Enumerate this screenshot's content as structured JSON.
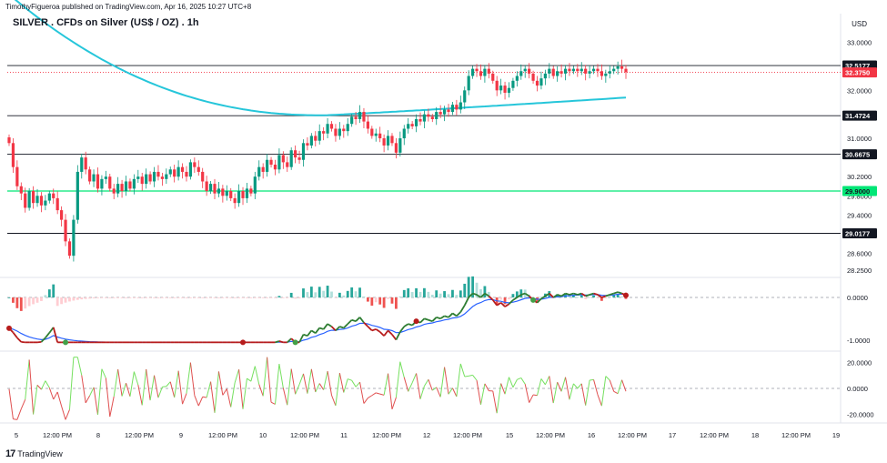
{
  "header": {
    "published": "TimothyFigueroa published on TradingView.com, Apr 16, 2025 10:27 UTC+8",
    "symbol": "SILVER . CFDs on Silver (US$ / OZ) . 1h",
    "currency": "USD"
  },
  "brand": {
    "logo": "TradingView"
  },
  "colors": {
    "up": "#089981",
    "down": "#f23645",
    "ma": "#26c6da",
    "macd_fast": "#2e7d32",
    "macd_slow": "#2962ff",
    "hist_up": "#26a69a",
    "hist_up_light": "#b2dfdb",
    "hist_down": "#ef5350",
    "hist_down_light": "#ffcdd2",
    "osc_up": "#76e060",
    "osc_down": "#e05050",
    "green_level": "#00e676"
  },
  "chart_data": [
    {
      "type": "candlestick",
      "price_ticks": [
        "33.0000",
        "32.0000",
        "31.0000",
        "30.2000",
        "29.8000",
        "29.4000",
        "28.6000",
        "28.2500"
      ],
      "price_labels": [
        {
          "value": "32.5177",
          "kind": "black"
        },
        {
          "value": "32.3750",
          "kind": "red"
        },
        {
          "value": "31.4724",
          "kind": "black"
        },
        {
          "value": "30.6675",
          "kind": "black"
        },
        {
          "value": "29.9000",
          "kind": "green"
        },
        {
          "value": "29.0177",
          "kind": "black"
        }
      ],
      "horizontal_levels": [
        32.5177,
        31.4724,
        30.6675,
        29.9,
        29.0177
      ],
      "green_level": 29.9,
      "last_price": 32.375,
      "time_labels": [
        "5",
        "12:00 PM",
        "8",
        "12:00 PM",
        "9",
        "12:00 PM",
        "10",
        "12:00 PM",
        "11",
        "12:00 PM",
        "12",
        "12:00 PM",
        "15",
        "12:00 PM",
        "16",
        "12:00 PM",
        "17",
        "12:00 PM",
        "18",
        "12:00 PM",
        "19"
      ],
      "closes": [
        30.9,
        30.4,
        30.0,
        29.85,
        29.55,
        29.9,
        29.65,
        29.8,
        29.6,
        29.7,
        29.85,
        29.75,
        29.5,
        29.3,
        28.85,
        28.55,
        29.3,
        30.3,
        30.6,
        30.35,
        30.1,
        30.25,
        29.95,
        30.15,
        30.2,
        29.95,
        29.85,
        30.05,
        29.9,
        30.1,
        29.95,
        30.15,
        30.2,
        30.05,
        30.25,
        30.1,
        30.3,
        30.2,
        30.15,
        30.25,
        30.35,
        30.2,
        30.4,
        30.3,
        30.2,
        30.5,
        30.4,
        30.3,
        30.1,
        29.9,
        30.05,
        29.85,
        29.95,
        29.8,
        29.9,
        29.75,
        29.65,
        29.9,
        29.75,
        29.95,
        29.85,
        30.2,
        30.4,
        30.3,
        30.55,
        30.45,
        30.35,
        30.65,
        30.5,
        30.4,
        30.75,
        30.6,
        30.55,
        30.9,
        30.85,
        31.05,
        30.95,
        31.15,
        31.1,
        31.3,
        31.2,
        31.05,
        31.2,
        31.15,
        31.3,
        31.45,
        31.4,
        31.55,
        31.35,
        31.2,
        31.05,
        31.1,
        31.0,
        30.85,
        31.05,
        30.9,
        30.7,
        31.0,
        31.2,
        31.3,
        31.25,
        31.4,
        31.35,
        31.5,
        31.45,
        31.4,
        31.55,
        31.5,
        31.6,
        31.55,
        31.7,
        31.6,
        31.75,
        32.0,
        32.3,
        32.45,
        32.4,
        32.3,
        32.45,
        32.35,
        32.2,
        32.0,
        32.1,
        31.95,
        32.05,
        32.2,
        32.3,
        32.4,
        32.45,
        32.35,
        32.2,
        32.1,
        32.25,
        32.35,
        32.45,
        32.3,
        32.4,
        32.35,
        32.45,
        32.4,
        32.45,
        32.4,
        32.45,
        32.35,
        32.4,
        32.45,
        32.4,
        32.3,
        32.35,
        32.4,
        32.45,
        32.5,
        32.45,
        32.38
      ],
      "ma": {
        "start": 34.0,
        "min_index": 78,
        "min": 31.48,
        "end": 31.85
      }
    },
    {
      "type": "line",
      "zero_label": "0.0000",
      "ticks": [
        "-1.0000"
      ],
      "range": [
        -1.75,
        0.45
      ],
      "markers": [
        {
          "index": 0,
          "kind": "red"
        },
        {
          "index": 11,
          "kind": "green"
        },
        {
          "index": 45,
          "kind": "red"
        },
        {
          "index": 55,
          "kind": "green"
        },
        {
          "index": 78,
          "kind": "red"
        },
        {
          "index": 100,
          "kind": "green"
        },
        {
          "index": 118,
          "kind": "red"
        }
      ]
    },
    {
      "type": "line",
      "zero_label": "0.0000",
      "ticks": [
        "20.0000",
        "-20.0000"
      ],
      "range": [
        -26,
        28
      ]
    }
  ]
}
